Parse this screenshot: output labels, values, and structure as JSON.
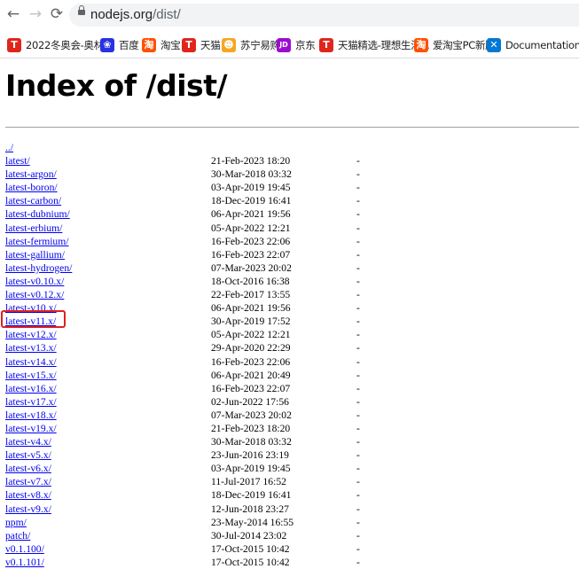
{
  "browser": {
    "url_host": "nodejs.org",
    "url_path": "/dist/"
  },
  "bookmarks": [
    {
      "label": "2022冬奥会-奥林...",
      "icon": "tmall-t-icon",
      "icon_text": "T",
      "color": "#e1251b"
    },
    {
      "label": "百度",
      "icon": "baidu-paw-icon",
      "icon_text": "❀",
      "color": "#2932e1"
    },
    {
      "label": "淘宝",
      "icon": "taobao-icon",
      "icon_text": "淘",
      "color": "#ff5000"
    },
    {
      "label": "天猫",
      "icon": "tmall-t-icon",
      "icon_text": "T",
      "color": "#e1251b"
    },
    {
      "label": "苏宁易购",
      "icon": "suning-icon",
      "icon_text": "☻",
      "color": "#f5a623"
    },
    {
      "label": "京东",
      "icon": "jd-icon",
      "icon_text": "JD",
      "color": "#9b0bd1"
    },
    {
      "label": "天猫精选-理想生活...",
      "icon": "tmall-t-icon",
      "icon_text": "T",
      "color": "#e1251b"
    },
    {
      "label": "爱淘宝PC新版",
      "icon": "taobao-icon",
      "icon_text": "淘",
      "color": "#ff5000"
    },
    {
      "label": "Documentation f...",
      "icon": "vscode-icon",
      "icon_text": "✕",
      "color": "#0078d4"
    }
  ],
  "page": {
    "title": "Index of /dist/"
  },
  "listing": [
    {
      "name": "../",
      "date": "",
      "size": ""
    },
    {
      "name": "latest/",
      "date": "21-Feb-2023 18:20",
      "size": "-"
    },
    {
      "name": "latest-argon/",
      "date": "30-Mar-2018 03:32",
      "size": "-"
    },
    {
      "name": "latest-boron/",
      "date": "03-Apr-2019 19:45",
      "size": "-"
    },
    {
      "name": "latest-carbon/",
      "date": "18-Dec-2019 16:41",
      "size": "-"
    },
    {
      "name": "latest-dubnium/",
      "date": "06-Apr-2021 19:56",
      "size": "-"
    },
    {
      "name": "latest-erbium/",
      "date": "05-Apr-2022 12:21",
      "size": "-"
    },
    {
      "name": "latest-fermium/",
      "date": "16-Feb-2023 22:06",
      "size": "-"
    },
    {
      "name": "latest-gallium/",
      "date": "16-Feb-2023 22:07",
      "size": "-"
    },
    {
      "name": "latest-hydrogen/",
      "date": "07-Mar-2023 20:02",
      "size": "-"
    },
    {
      "name": "latest-v0.10.x/",
      "date": "18-Oct-2016 16:38",
      "size": "-"
    },
    {
      "name": "latest-v0.12.x/",
      "date": "22-Feb-2017 13:55",
      "size": "-"
    },
    {
      "name": "latest-v10.x/",
      "date": "06-Apr-2021 19:56",
      "size": "-"
    },
    {
      "name": "latest-v11.x/",
      "date": "30-Apr-2019 17:52",
      "size": "-"
    },
    {
      "name": "latest-v12.x/",
      "date": "05-Apr-2022 12:21",
      "size": "-"
    },
    {
      "name": "latest-v13.x/",
      "date": "29-Apr-2020 22:29",
      "size": "-"
    },
    {
      "name": "latest-v14.x/",
      "date": "16-Feb-2023 22:06",
      "size": "-"
    },
    {
      "name": "latest-v15.x/",
      "date": "06-Apr-2021 20:49",
      "size": "-"
    },
    {
      "name": "latest-v16.x/",
      "date": "16-Feb-2023 22:07",
      "size": "-"
    },
    {
      "name": "latest-v17.x/",
      "date": "02-Jun-2022 17:56",
      "size": "-"
    },
    {
      "name": "latest-v18.x/",
      "date": "07-Mar-2023 20:02",
      "size": "-"
    },
    {
      "name": "latest-v19.x/",
      "date": "21-Feb-2023 18:20",
      "size": "-"
    },
    {
      "name": "latest-v4.x/",
      "date": "30-Mar-2018 03:32",
      "size": "-"
    },
    {
      "name": "latest-v5.x/",
      "date": "23-Jun-2016 23:19",
      "size": "-"
    },
    {
      "name": "latest-v6.x/",
      "date": "03-Apr-2019 19:45",
      "size": "-"
    },
    {
      "name": "latest-v7.x/",
      "date": "11-Jul-2017 16:52",
      "size": "-"
    },
    {
      "name": "latest-v8.x/",
      "date": "18-Dec-2019 16:41",
      "size": "-"
    },
    {
      "name": "latest-v9.x/",
      "date": "12-Jun-2018 23:27",
      "size": "-"
    },
    {
      "name": "npm/",
      "date": "23-May-2014 16:55",
      "size": "-"
    },
    {
      "name": "patch/",
      "date": "30-Jul-2014 23:02",
      "size": "-"
    },
    {
      "name": "v0.1.100/",
      "date": "17-Oct-2015 10:42",
      "size": "-"
    },
    {
      "name": "v0.1.101/",
      "date": "17-Oct-2015 10:42",
      "size": "-"
    }
  ],
  "highlight_color": "#e02020"
}
